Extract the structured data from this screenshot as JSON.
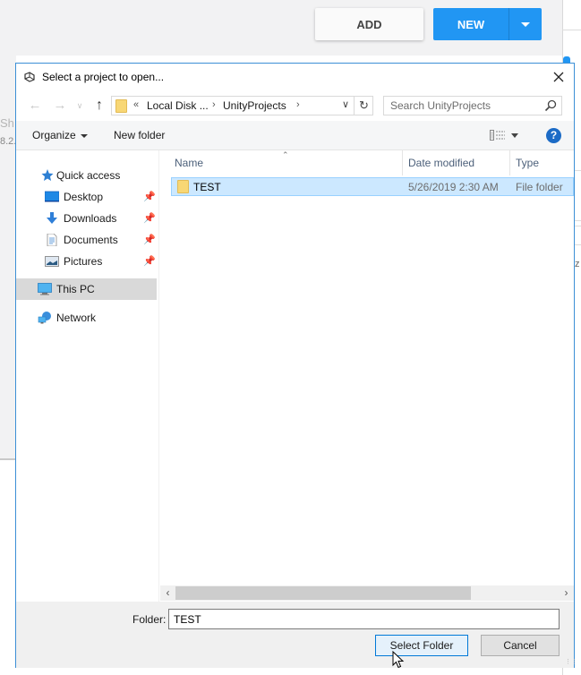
{
  "background_app": {
    "add_button": "ADD",
    "new_button": "NEW",
    "new_dropdown_icon": "caret-down-icon",
    "partial_text_1": "Sh",
    "partial_text_2": "8.2.",
    "partial_text_3": "z",
    "accent_color": "#2196f3"
  },
  "dialog": {
    "title": "Select a project to open...",
    "title_icon": "unity-logo-icon",
    "close_icon": "close-icon",
    "navigation": {
      "back_icon": "arrow-left-icon",
      "forward_icon": "arrow-right-icon",
      "recent_icon": "chevron-down-icon",
      "up_icon": "arrow-up-icon"
    },
    "address_bar": {
      "overflow": "«",
      "crumbs": [
        "Local Disk ...",
        "UnityProjects"
      ],
      "separator": "›",
      "refresh_icon": "refresh-icon"
    },
    "search": {
      "placeholder": "Search UnityProjects",
      "icon": "search-icon"
    },
    "toolbar": {
      "organize": "Organize",
      "new_folder": "New folder",
      "view_icon": "view-details-icon",
      "help": "?"
    },
    "nav_pane": {
      "quick_access": "Quick access",
      "items": [
        {
          "label": "Desktop",
          "icon": "desktop-icon",
          "pinned": true
        },
        {
          "label": "Downloads",
          "icon": "downloads-icon",
          "pinned": true
        },
        {
          "label": "Documents",
          "icon": "documents-icon",
          "pinned": true
        },
        {
          "label": "Pictures",
          "icon": "pictures-icon",
          "pinned": true
        }
      ],
      "this_pc": "This PC",
      "network": "Network"
    },
    "file_list": {
      "columns": [
        "Name",
        "Date modified",
        "Type"
      ],
      "rows": [
        {
          "name": "TEST",
          "date_modified": "5/26/2019 2:30 AM",
          "type": "File folder",
          "selected": true
        }
      ]
    },
    "footer": {
      "folder_label": "Folder:",
      "folder_value": "TEST",
      "select_button": "Select Folder",
      "cancel_button": "Cancel"
    }
  }
}
